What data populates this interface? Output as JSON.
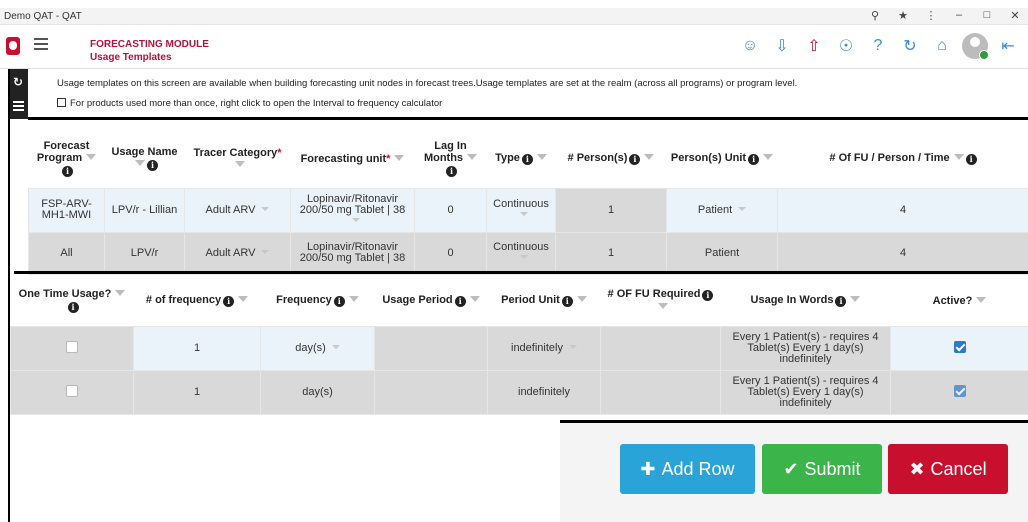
{
  "window": {
    "title": "Demo QAT - QAT"
  },
  "header": {
    "module": "FORECASTING MODULE",
    "page": "Usage Templates"
  },
  "info": {
    "line1": "Usage templates on this screen are available when building forecasting unit nodes in forecast trees.Usage templates are set at the realm (across all programs) or program level.",
    "line2": "For products used more than once, right click to open the Interval to frequency calculator"
  },
  "table1": {
    "headers": {
      "program": "Forecast Program",
      "usage_name": "Usage Name",
      "tracer": "Tracer Category",
      "fu": "Forecasting unit",
      "lag": "Lag In Months",
      "type": "Type",
      "persons": "# Person(s)",
      "person_unit": "Person(s) Unit",
      "fu_per_person": "# Of FU / Person / Time"
    },
    "rows": [
      {
        "program": "FSP-ARV-MH1-MWI",
        "usage_name": "LPV/r - Lillian",
        "tracer": "Adult ARV",
        "fu": "Lopinavir/Ritonavir 200/50 mg Tablet | 38",
        "lag": "0",
        "type": "Continuous",
        "persons": "1",
        "person_unit": "Patient",
        "fu_per_person": "4"
      },
      {
        "program": "All",
        "usage_name": "LPV/r",
        "tracer": "Adult ARV",
        "fu": "Lopinavir/Ritonavir 200/50 mg Tablet | 38",
        "lag": "0",
        "type": "Continuous",
        "persons": "1",
        "person_unit": "Patient",
        "fu_per_person": "4"
      }
    ]
  },
  "table2": {
    "headers": {
      "one_time": "One Time Usage?",
      "num_freq": "# of frequency",
      "freq": "Frequency",
      "usage_period": "Usage Period",
      "period_unit": "Period Unit",
      "fu_required": "# OF FU Required",
      "usage_words": "Usage In Words",
      "active": "Active?"
    },
    "rows": [
      {
        "num_freq": "1",
        "freq": "day(s)",
        "period_unit": "indefinitely",
        "usage_words": "Every 1 Patient(s) - requires 4 Tablet(s) Every 1 day(s) indefinitely",
        "active": true
      },
      {
        "num_freq": "1",
        "freq": "day(s)",
        "period_unit": "indefinitely",
        "usage_words": "Every 1 Patient(s) - requires 4 Tablet(s) Every 1 day(s) indefinitely",
        "active": true
      }
    ]
  },
  "buttons": {
    "add_row": "Add Row",
    "submit": "Submit",
    "cancel": "Cancel"
  }
}
